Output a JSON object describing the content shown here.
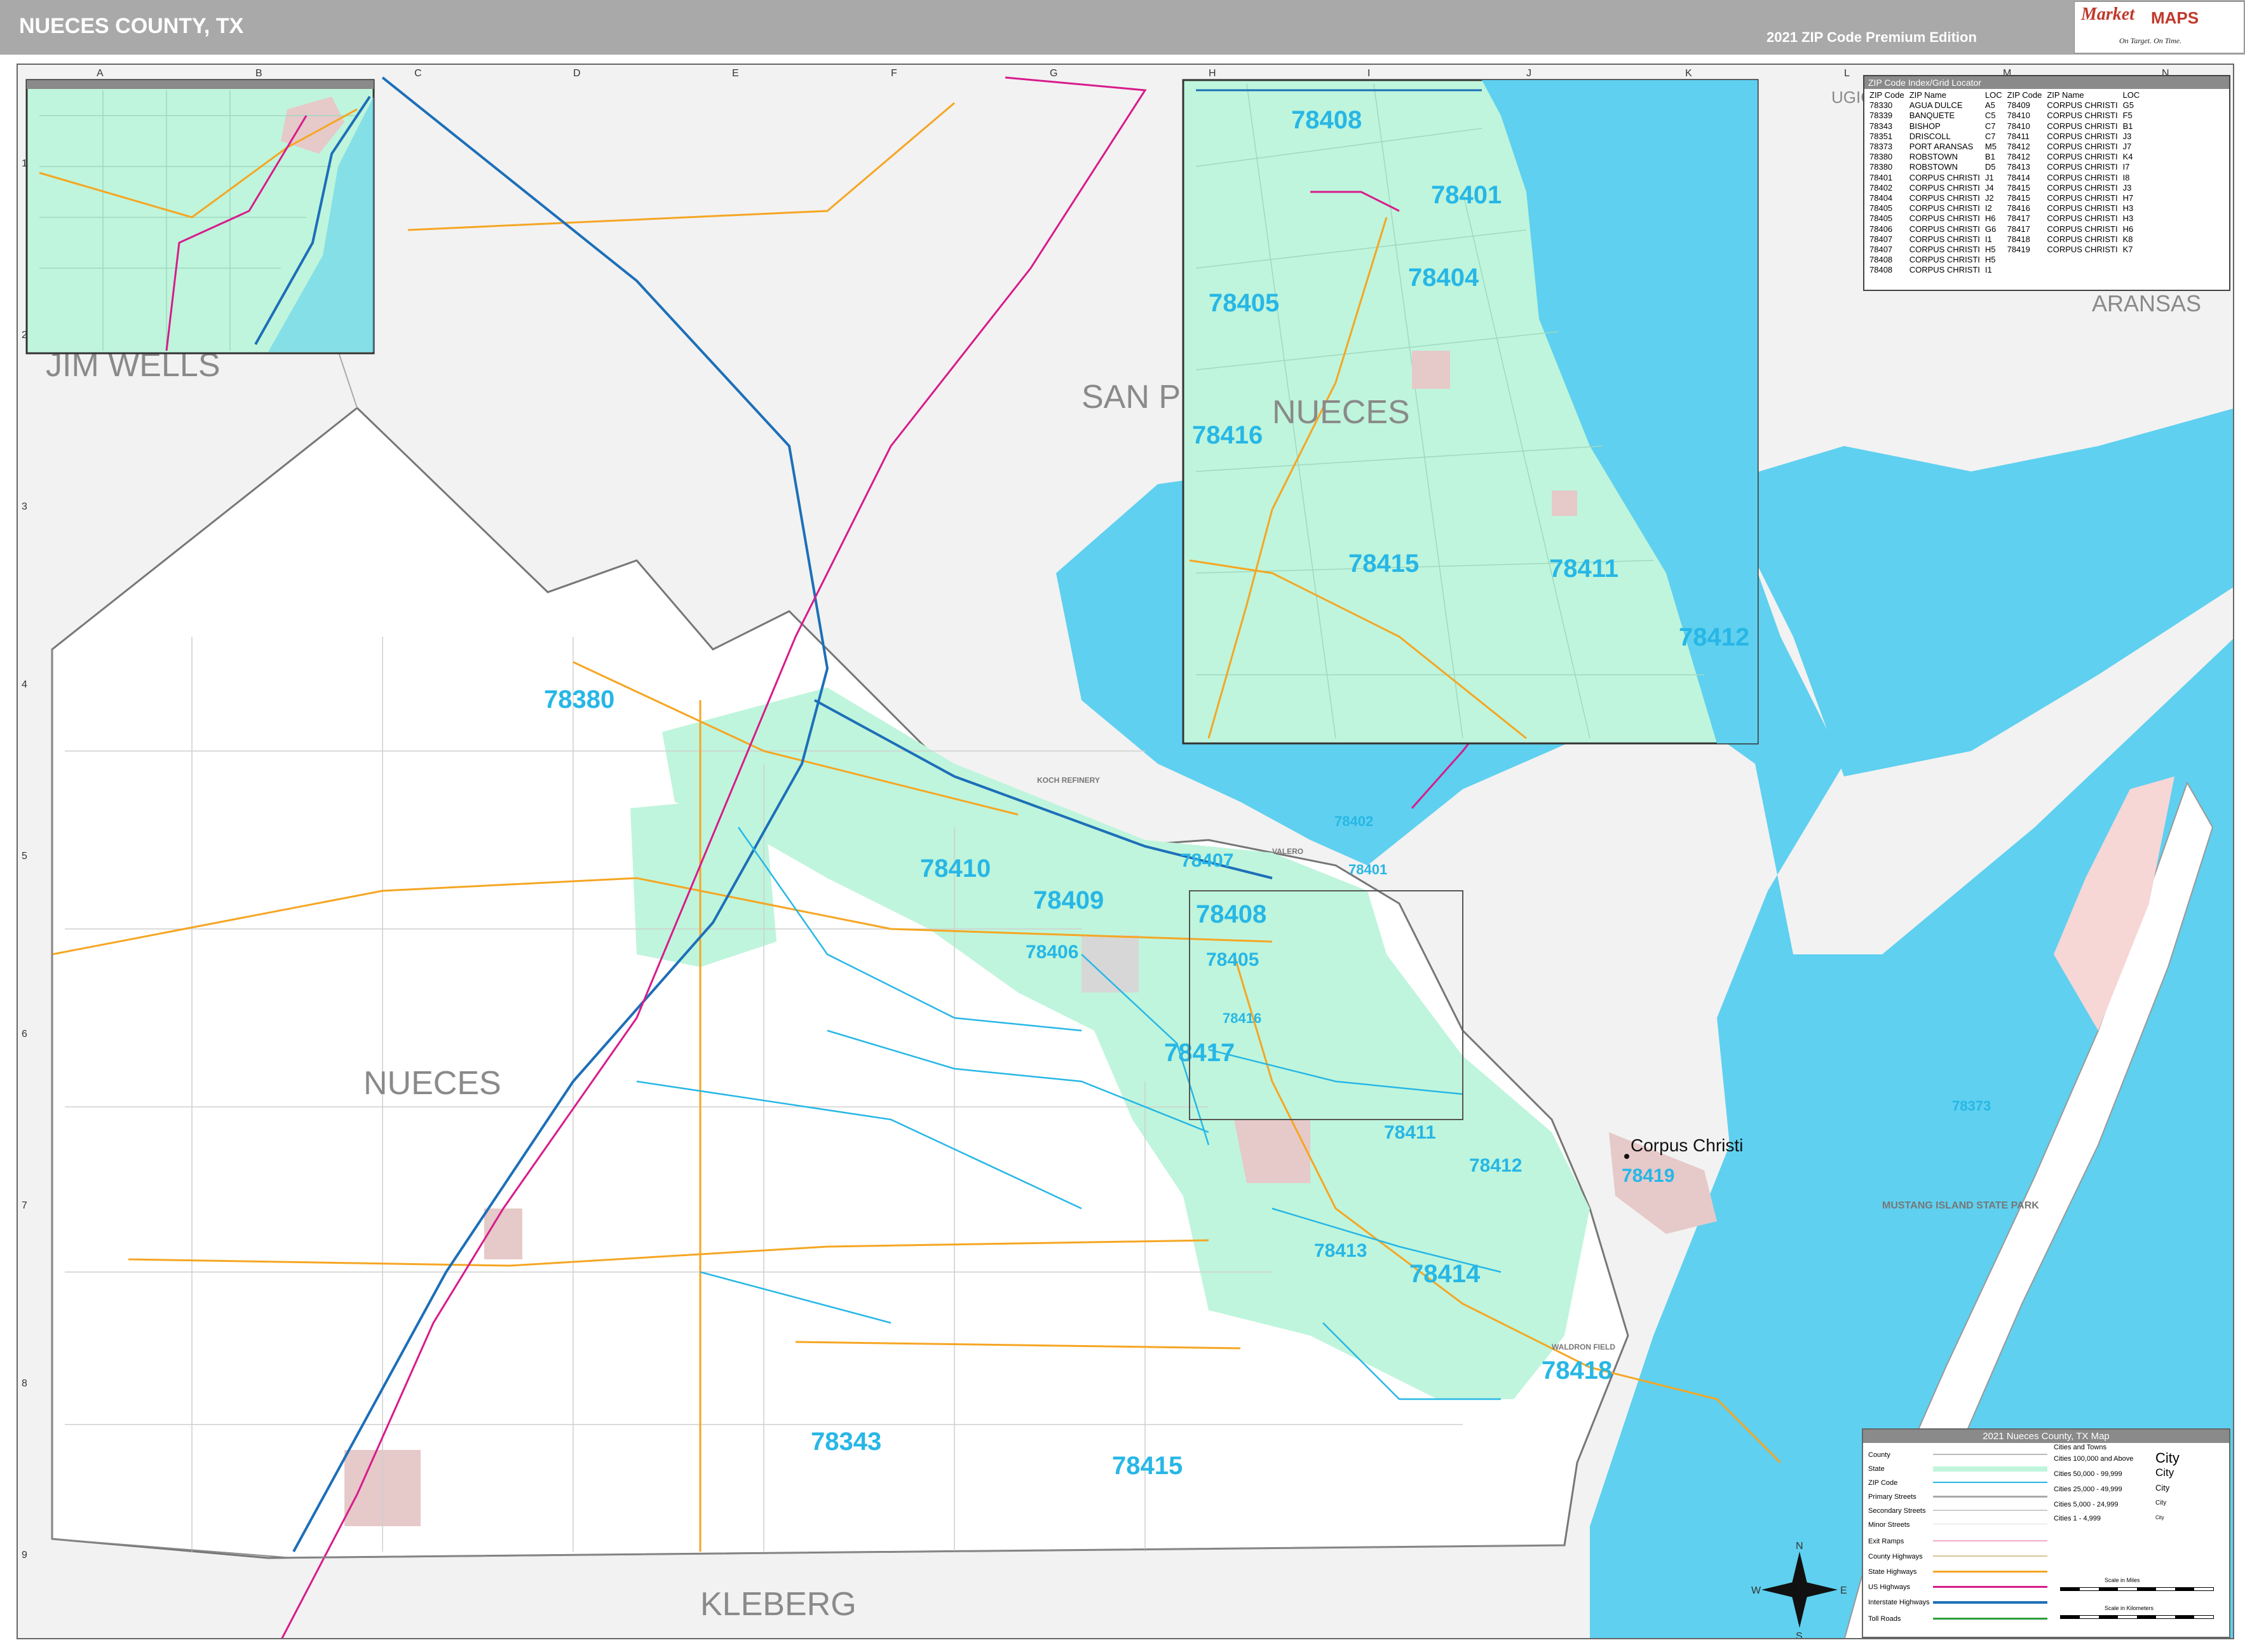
{
  "header": {
    "title": "NUECES COUNTY, TX",
    "edition": "2021 ZIP Code Premium Edition"
  },
  "logo": {
    "brand_market": "Market",
    "brand_maps": "MAPS",
    "tagline": "On Target. On Time.",
    "icon": "market-maps-logo-icon"
  },
  "grid": {
    "columns": [
      "A",
      "B",
      "C",
      "D",
      "E",
      "F",
      "G",
      "H",
      "I",
      "J",
      "K",
      "L",
      "M",
      "N"
    ],
    "rows": [
      "1",
      "2",
      "3",
      "4",
      "5",
      "6",
      "7",
      "8",
      "9"
    ]
  },
  "counties": {
    "jim_wells": "JIM WELLS",
    "san_patricio": "SAN P",
    "nueces": "NUECES",
    "kleberg": "KLEBERG",
    "aransas": "ARANSAS",
    "refugio": "UGIO"
  },
  "zips": {
    "z78380": "78380",
    "z78410": "78410",
    "z78409": "78409",
    "z78407": "78407",
    "z78408": "78408",
    "z78406": "78406",
    "z78405": "78405",
    "z78416": "78416",
    "z78417": "78417",
    "z78411": "78411",
    "z78412": "78412",
    "z78413": "78413",
    "z78414": "78414",
    "z78418": "78418",
    "z78419": "78419",
    "z78343": "78343",
    "z78415": "78415",
    "z78373": "78373",
    "z78402": "78402",
    "z78401": "78401"
  },
  "inset_zips": {
    "z78408": "78408",
    "z78401": "78401",
    "z78404": "78404",
    "z78405": "78405",
    "z78416": "78416",
    "z78415": "78415",
    "z78411": "78411",
    "z78412": "78412",
    "county": "NUECES"
  },
  "places": {
    "corpus_christi": "Corpus Christi",
    "mustang_park": "MUSTANG ISLAND STATE PARK",
    "waldron": "WALDRON FIELD",
    "koch": "KOCH REFINERY",
    "valero": "VALERO"
  },
  "index_table": {
    "title": "ZIP Code Index/Grid Locator",
    "headers": [
      "ZIP Code",
      "ZIP Name",
      "LOC",
      "ZIP Code",
      "ZIP Name",
      "LOC"
    ],
    "rows": [
      [
        "78330",
        "AGUA DULCE",
        "A5",
        "78409",
        "CORPUS CHRISTI",
        "G5"
      ],
      [
        "78339",
        "BANQUETE",
        "C5",
        "78410",
        "CORPUS CHRISTI",
        "F5"
      ],
      [
        "78343",
        "BISHOP",
        "C7",
        "78410",
        "CORPUS CHRISTI",
        "B1"
      ],
      [
        "78351",
        "DRISCOLL",
        "C7",
        "78411",
        "CORPUS CHRISTI",
        "J3"
      ],
      [
        "78373",
        "PORT ARANSAS",
        "M5",
        "78412",
        "CORPUS CHRISTI",
        "J7"
      ],
      [
        "78380",
        "ROBSTOWN",
        "B1",
        "78412",
        "CORPUS CHRISTI",
        "K4"
      ],
      [
        "78380",
        "ROBSTOWN",
        "D5",
        "78413",
        "CORPUS CHRISTI",
        "I7"
      ],
      [
        "78401",
        "CORPUS CHRISTI",
        "J1",
        "78414",
        "CORPUS CHRISTI",
        "I8"
      ],
      [
        "78402",
        "CORPUS CHRISTI",
        "J4",
        "78415",
        "CORPUS CHRISTI",
        "J3"
      ],
      [
        "78404",
        "CORPUS CHRISTI",
        "J2",
        "78415",
        "CORPUS CHRISTI",
        "H7"
      ],
      [
        "78405",
        "CORPUS CHRISTI",
        "I2",
        "78416",
        "CORPUS CHRISTI",
        "H3"
      ],
      [
        "78405",
        "CORPUS CHRISTI",
        "H6",
        "78417",
        "CORPUS CHRISTI",
        "H3"
      ],
      [
        "78406",
        "CORPUS CHRISTI",
        "G6",
        "78417",
        "CORPUS CHRISTI",
        "H6"
      ],
      [
        "78407",
        "CORPUS CHRISTI",
        "I1",
        "78418",
        "CORPUS CHRISTI",
        "K8"
      ],
      [
        "78407",
        "CORPUS CHRISTI",
        "H5",
        "78419",
        "CORPUS CHRISTI",
        "K7"
      ],
      [
        "78408",
        "CORPUS CHRISTI",
        "H5",
        "",
        "",
        ""
      ],
      [
        "78408",
        "CORPUS CHRISTI",
        "I1",
        "",
        "",
        ""
      ]
    ]
  },
  "legend": {
    "title": "2021 Nueces County, TX Map",
    "items": [
      "County",
      "State",
      "ZIP Code",
      "Primary Streets",
      "Secondary Streets",
      "Minor Streets",
      "Exit Ramps",
      "County Highways",
      "State Highways",
      "US Highways",
      "Interstate Highways",
      "Toll Roads"
    ],
    "city_header": "Cities and Towns",
    "city_ranges": [
      "Cities 100,000 and Above",
      "Cities 50,000 - 99,999",
      "Cities 25,000 - 49,999",
      "Cities 5,000 - 24,999",
      "Cities 1 - 4,999"
    ],
    "city_samples": [
      "City",
      "City",
      "City",
      "City",
      "City"
    ],
    "scale_miles": "Scale in Miles",
    "scale_km": "Scale in Kilometers"
  },
  "compass": {
    "n": "N",
    "s": "S",
    "e": "E",
    "w": "W"
  },
  "colors": {
    "zip_fill": "#bff5dc",
    "water": "#5fd0ef",
    "land_outside": "#f2f2f2",
    "urban": "#e6c9c9",
    "interstate": "#1d6fb8",
    "us_highway": "#d81b8b",
    "state_highway": "#f5a623",
    "zip_label": "#27b7e6"
  }
}
